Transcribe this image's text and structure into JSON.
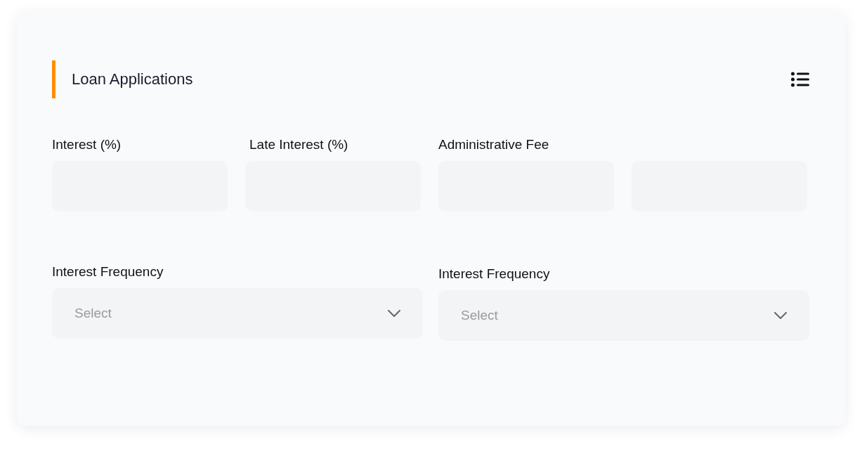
{
  "header": {
    "title": "Loan Applications"
  },
  "fields": [
    {
      "label": "Interest (%)",
      "kind": "single"
    },
    {
      "label": "Late Interest (%)",
      "kind": "single"
    },
    {
      "label": "Administrative Fee",
      "kind": "pair"
    }
  ],
  "selects": [
    {
      "label": "Interest Frequency",
      "placeholder": "Select"
    },
    {
      "label": "Interest Frequency",
      "placeholder": "Select"
    }
  ]
}
